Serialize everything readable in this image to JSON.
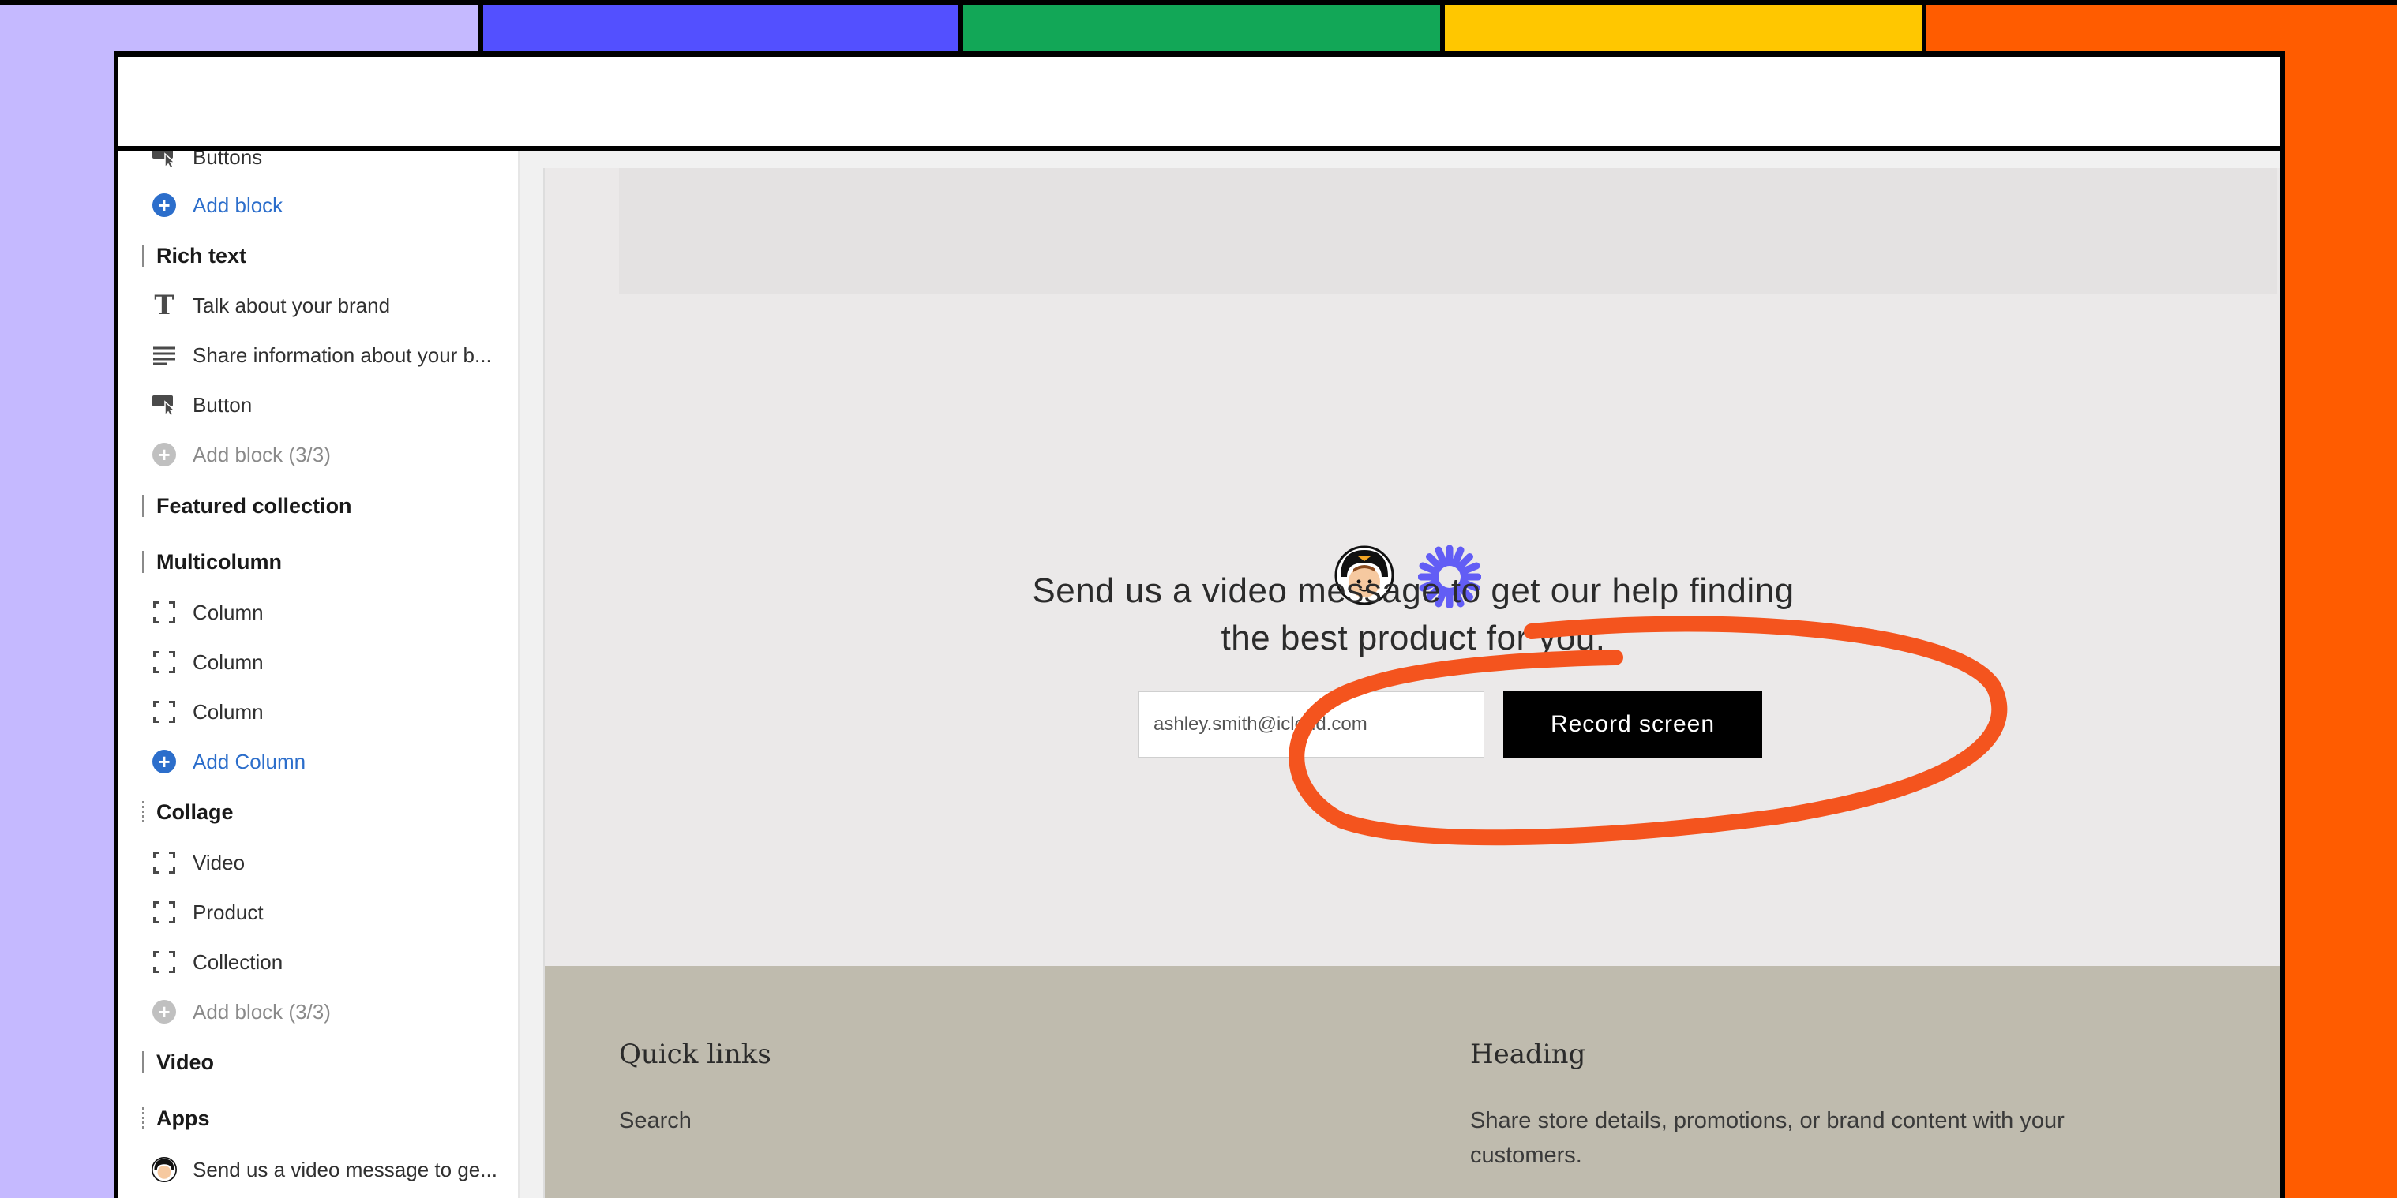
{
  "colors": {
    "band_lavender": "#c5b9ff",
    "band_blue": "#5350ff",
    "band_green": "#12a757",
    "band_yellow": "#ffc700",
    "band_orange": "#ff5c00",
    "annotation_stroke": "#f4541e",
    "accent_blue": "#2c6ecb",
    "footer_bg": "#bfbbae"
  },
  "sidebar": {
    "items": [
      {
        "type": "block",
        "icon": "button-cursor-icon",
        "label": "Buttons"
      },
      {
        "type": "add",
        "icon": "plus-circle-icon",
        "label": "Add block"
      },
      {
        "type": "section",
        "label": "Rich text"
      },
      {
        "type": "block",
        "icon": "text-t-icon",
        "label": "Talk about your brand"
      },
      {
        "type": "block",
        "icon": "paragraph-lines-icon",
        "label": "Share information about your b..."
      },
      {
        "type": "block",
        "icon": "button-cursor-icon",
        "label": "Button"
      },
      {
        "type": "add-disabled",
        "icon": "plus-circle-icon",
        "label": "Add block (3/3)"
      },
      {
        "type": "section",
        "label": "Featured collection"
      },
      {
        "type": "section",
        "label": "Multicolumn"
      },
      {
        "type": "block",
        "icon": "column-bracket-icon",
        "label": "Column"
      },
      {
        "type": "block",
        "icon": "column-bracket-icon",
        "label": "Column"
      },
      {
        "type": "block",
        "icon": "column-bracket-icon",
        "label": "Column"
      },
      {
        "type": "add",
        "icon": "plus-circle-icon",
        "label": "Add Column"
      },
      {
        "type": "section",
        "label": "Collage"
      },
      {
        "type": "block",
        "icon": "column-bracket-icon",
        "label": "Video"
      },
      {
        "type": "block",
        "icon": "column-bracket-icon",
        "label": "Product"
      },
      {
        "type": "block",
        "icon": "column-bracket-icon",
        "label": "Collection"
      },
      {
        "type": "add-disabled",
        "icon": "plus-circle-icon",
        "label": "Add block (3/3)"
      },
      {
        "type": "section",
        "label": "Video"
      },
      {
        "type": "section",
        "label": "Apps"
      },
      {
        "type": "block",
        "icon": "avatar-icon",
        "label": "Send us a video message to ge..."
      }
    ]
  },
  "preview": {
    "logos": [
      "penguin-avatar-icon",
      "loom-starburst-icon"
    ],
    "headline": "Send us a video message to get our help finding the best product for you.",
    "email_value": "ashley.smith@icloud.com",
    "record_button": "Record screen"
  },
  "footer": {
    "col1_title": "Quick links",
    "col1_link": "Search",
    "col2_title": "Heading",
    "col2_text": "Share store details, promotions, or brand content with your customers."
  }
}
